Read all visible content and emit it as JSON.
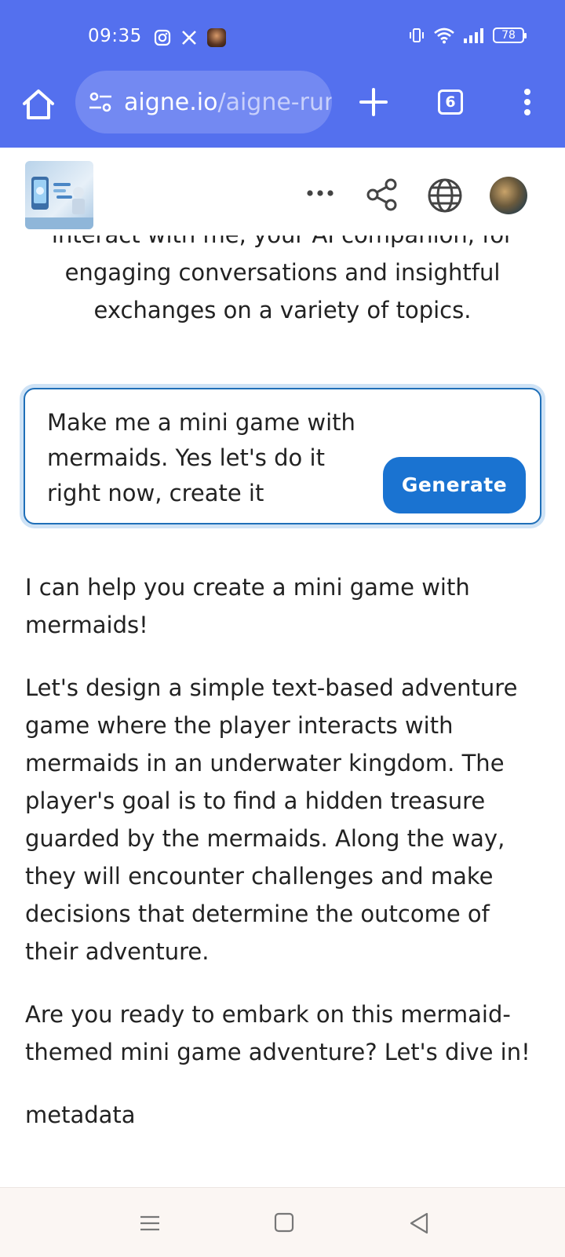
{
  "status_bar": {
    "time": "09:35",
    "left_icons": [
      "instagram-icon",
      "x-icon",
      "app-avatar-icon"
    ],
    "right_icons": [
      "vibrate-icon",
      "wifi-icon",
      "signal-icon"
    ],
    "battery": "78"
  },
  "browser": {
    "url_host": "aigne.io",
    "url_path": "/aigne-run",
    "tab_count": "6",
    "accent": "#5470ee"
  },
  "app_header": {
    "icons": [
      "more-icon",
      "share-icon",
      "globe-icon",
      "user-avatar"
    ]
  },
  "intro": {
    "clipped_line": "interact with me, your AI companion, for",
    "text": "engaging conversations and insightful exchanges on a variety of topics."
  },
  "prompt": {
    "value": "Make me a mini game with mermaids. Yes let's do it right now, create it",
    "generate_label": "Generate"
  },
  "response": {
    "paragraphs": [
      "I can help you create a mini game with mermaids!",
      "Let's design a simple text-based adventure game where the player interacts with mermaids in an underwater kingdom. The player's goal is to find a hidden treasure guarded by the mermaids. Along the way, they will encounter challenges and make decisions that determine the outcome of their adventure.",
      "Are you ready to embark on this mermaid-themed mini game adventure? Let's dive in!",
      "metadata"
    ]
  },
  "nav_bar": {
    "icons": [
      "recents-icon",
      "home-icon",
      "back-icon"
    ]
  }
}
